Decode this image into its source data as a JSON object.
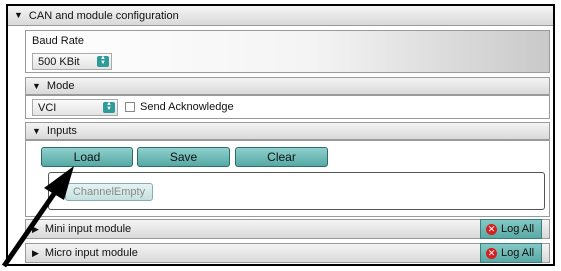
{
  "window": {
    "title": "CAN and module configuration"
  },
  "baud": {
    "title": "Baud Rate",
    "value": "500 KBit"
  },
  "mode": {
    "title": "Mode",
    "value": "VCI",
    "ack_label": "Send Acknowledge",
    "ack_checked": false
  },
  "inputs": {
    "title": "Inputs",
    "load_label": "Load",
    "save_label": "Save",
    "clear_label": "Clear",
    "channel_label": "ChannelEmpty"
  },
  "modules": [
    {
      "label": "Mini input module",
      "log_label": "Log All"
    },
    {
      "label": "Micro input module",
      "log_label": "Log All"
    }
  ],
  "icons": {
    "expanded": "triangle-down-icon",
    "collapsed": "triangle-right-icon",
    "spinner": "spinner-icon",
    "remove": "x-circle-icon",
    "pointer": "arrow-pointer-icon"
  },
  "colors": {
    "accent": "#5aa9a5",
    "remove": "#d42020"
  }
}
